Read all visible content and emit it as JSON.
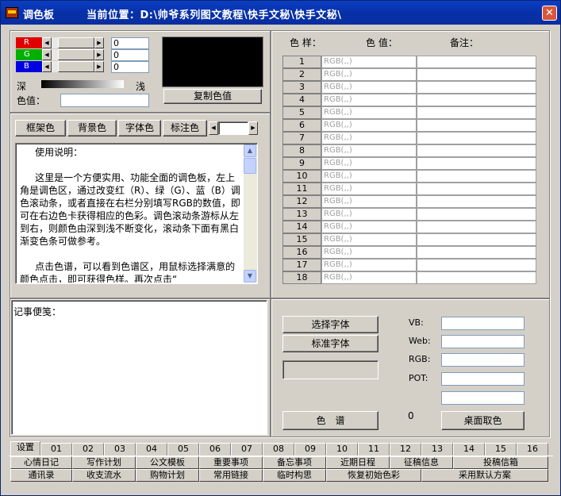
{
  "window": {
    "title": "调色板",
    "location": "当前位置：D:\\帅爷系列图文教程\\快手文秘\\快手文秘\\",
    "close_glyph": "✕"
  },
  "color_picker": {
    "channels": [
      {
        "label": "R",
        "value": "0",
        "color": "#e00000"
      },
      {
        "label": "G",
        "value": "0",
        "color": "#00b000"
      },
      {
        "label": "B",
        "value": "0",
        "color": "#0000e0"
      }
    ],
    "dark_label": "深",
    "light_label": "浅",
    "value_label": "色值：",
    "value_input": "",
    "preview_color": "#000000",
    "copy_button": "复制色值"
  },
  "target_buttons": [
    "框架色",
    "背景色",
    "字体色",
    "标注色"
  ],
  "manual": {
    "text": "     使用说明：\n\n     这里是一个方便实用、功能全面的调色板，左上角是调色区，通过改变红（R）、绿（G）、蓝（B）调色滚动条，或者直接在右栏分别填写RGB的数值，即可在右边色卡获得相应的色彩。调色滚动条游标从左到右，则颜色由深到浅不断变化，滚动条下面有黑白渐变色条可做参考。\n\n     点击色谱，可以看到色谱区，用鼠标选择满意的颜色点击，即可获得色样。再次点击“"
  },
  "notes": {
    "label": "记事便笺："
  },
  "swatch_table": {
    "headers": [
      "色 样：",
      "色 值：",
      "备注："
    ],
    "rows": [
      {
        "num": "1",
        "rgb": "RGB(,,)"
      },
      {
        "num": "2",
        "rgb": "RGB(,,)"
      },
      {
        "num": "3",
        "rgb": "RGB(,,)"
      },
      {
        "num": "4",
        "rgb": "RGB(,,)"
      },
      {
        "num": "5",
        "rgb": "RGB(,,)"
      },
      {
        "num": "6",
        "rgb": "RGB(,,)"
      },
      {
        "num": "7",
        "rgb": "RGB(,,)"
      },
      {
        "num": "8",
        "rgb": "RGB(,,)"
      },
      {
        "num": "9",
        "rgb": "RGB(,,)"
      },
      {
        "num": "10",
        "rgb": "RGB(,,)"
      },
      {
        "num": "11",
        "rgb": "RGB(,,)"
      },
      {
        "num": "12",
        "rgb": "RGB(,,)"
      },
      {
        "num": "13",
        "rgb": "RGB(,,)"
      },
      {
        "num": "14",
        "rgb": "RGB(,,)"
      },
      {
        "num": "15",
        "rgb": "RGB(,,)"
      },
      {
        "num": "16",
        "rgb": "RGB(,,)"
      },
      {
        "num": "17",
        "rgb": "RGB(,,)"
      },
      {
        "num": "18",
        "rgb": "RGB(,,)"
      }
    ]
  },
  "font_panel": {
    "choose_font": "选择字体",
    "standard_font": "标准字体",
    "spectrum": "色　谱",
    "desktop_pick": "桌面取色",
    "zero_value": "0",
    "fields": [
      "VB:",
      "Web:",
      "RGB:",
      "POT:",
      ""
    ]
  },
  "tabs": [
    "设置",
    "01",
    "02",
    "03",
    "04",
    "05",
    "06",
    "07",
    "08",
    "09",
    "10",
    "11",
    "12",
    "13",
    "14",
    "15",
    "16"
  ],
  "bottom_row1": [
    "心情日记",
    "写作计划",
    "公文模板",
    "重要事项",
    "备忘事项",
    "近期日程",
    "征稿信息",
    "投稿信箱"
  ],
  "bottom_row2": [
    "通讯录",
    "收支流水",
    "购物计划",
    "常用链接",
    "临时构思",
    "恢复初始色彩",
    "采用默认方案"
  ]
}
